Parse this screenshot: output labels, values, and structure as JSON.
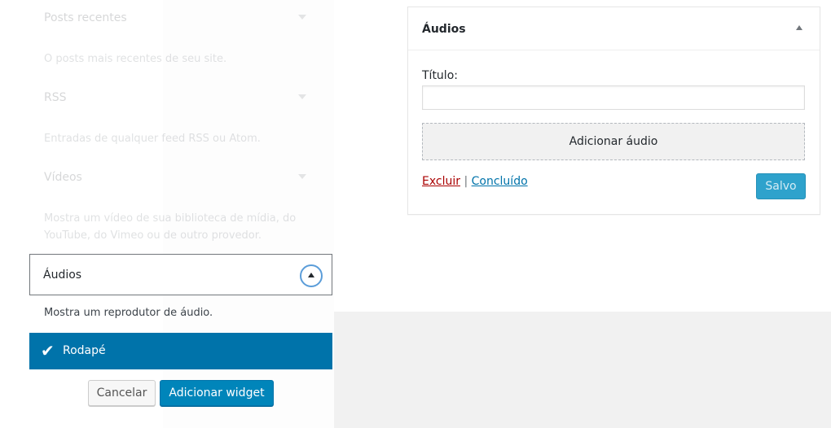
{
  "available_widgets": [
    {
      "title": "Posts recentes",
      "description": "O posts mais recentes de seu site."
    },
    {
      "title": "RSS",
      "description": "Entradas de qualquer feed RSS ou Atom."
    },
    {
      "title": "Vídeos",
      "description": "Mostra um vídeo de sua biblioteca de mídia, do YouTube, do Vimeo ou de outro provedor."
    }
  ],
  "selected_widget": {
    "title": "Áudios",
    "description": "Mostra um reprodutor de áudio.",
    "sidebar_option": "Rodapé",
    "cancel_label": "Cancelar",
    "add_label": "Adicionar widget"
  },
  "widget_panel": {
    "title": "Áudios",
    "field_label": "Título:",
    "field_value": "",
    "add_audio_label": "Adicionar áudio",
    "delete_label": "Excluir",
    "separator": " | ",
    "done_label": "Concluído",
    "saved_label": "Salvo"
  }
}
